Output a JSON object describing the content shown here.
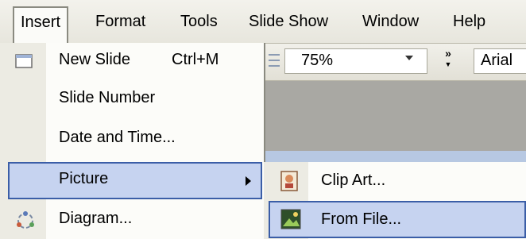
{
  "menubar": {
    "items": [
      {
        "label": "Insert",
        "open": true
      },
      {
        "label": "Format"
      },
      {
        "label": "Tools"
      },
      {
        "label": "Slide Show"
      },
      {
        "label": "Window"
      },
      {
        "label": "Help"
      }
    ]
  },
  "toolbar": {
    "zoom_value": "75%",
    "overflow_glyph": "»",
    "font_value": "Arial"
  },
  "insert_menu": {
    "items": [
      {
        "label": "New Slide",
        "shortcut": "Ctrl+M",
        "icon": "new-slide-icon"
      },
      {
        "label": "Slide Number"
      },
      {
        "label": "Date and Time..."
      },
      {
        "label": "Picture",
        "highlighted": true,
        "has_submenu": true
      },
      {
        "label": "Diagram...",
        "icon": "diagram-icon"
      }
    ]
  },
  "picture_submenu": {
    "items": [
      {
        "label": "Clip Art...",
        "icon": "clip-art-icon"
      },
      {
        "label": "From File...",
        "icon": "from-file-icon",
        "highlighted": true
      }
    ]
  },
  "colors": {
    "highlight_fill": "#c6d3f0",
    "highlight_border": "#3b5ea7",
    "menu_bg": "#fcfcf9",
    "gutter": "#ecebe3"
  }
}
